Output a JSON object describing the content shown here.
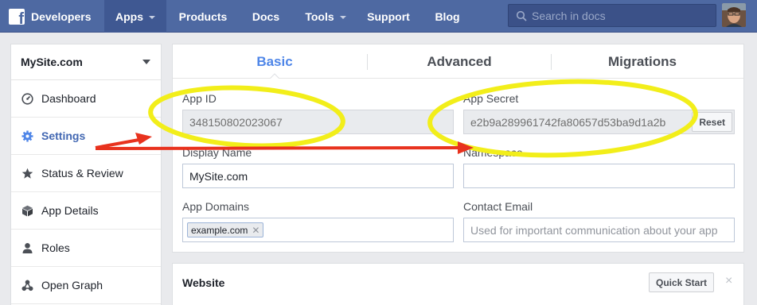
{
  "topbar": {
    "brand": "Developers",
    "nav": [
      {
        "label": "Apps",
        "active": true,
        "dropdown": true
      },
      {
        "label": "Products",
        "active": false,
        "dropdown": false
      },
      {
        "label": "Docs",
        "active": false,
        "dropdown": false
      },
      {
        "label": "Tools",
        "active": false,
        "dropdown": true
      },
      {
        "label": "Support",
        "active": false,
        "dropdown": false
      },
      {
        "label": "Blog",
        "active": false,
        "dropdown": false
      }
    ],
    "search_placeholder": "Search in docs"
  },
  "sidebar": {
    "site": "MySite.com",
    "items": [
      {
        "label": "Dashboard",
        "icon": "dashboard-icon",
        "active": false
      },
      {
        "label": "Settings",
        "icon": "gear-icon",
        "active": true
      },
      {
        "label": "Status & Review",
        "icon": "star-icon",
        "active": false
      },
      {
        "label": "App Details",
        "icon": "box-icon",
        "active": false
      },
      {
        "label": "Roles",
        "icon": "person-icon",
        "active": false
      },
      {
        "label": "Open Graph",
        "icon": "graph-icon",
        "active": false
      }
    ]
  },
  "tabs": [
    {
      "label": "Basic",
      "active": true
    },
    {
      "label": "Advanced",
      "active": false
    },
    {
      "label": "Migrations",
      "active": false
    }
  ],
  "fields": {
    "app_id": {
      "label": "App ID",
      "value": "348150802023067"
    },
    "app_secret": {
      "label": "App Secret",
      "value": "e2b9a289961742fa80657d53ba9d1a2b",
      "reset_label": "Reset"
    },
    "display_name": {
      "label": "Display Name",
      "value": "MySite.com"
    },
    "namespace": {
      "label": "Namespace",
      "value": ""
    },
    "app_domains": {
      "label": "App Domains",
      "tags": [
        "example.com"
      ]
    },
    "contact_email": {
      "label": "Contact Email",
      "placeholder": "Used for important communication about your app"
    }
  },
  "website": {
    "title": "Website",
    "quick_start_label": "Quick Start",
    "close_label": "×"
  },
  "colors": {
    "topbar": "#4e69a2",
    "accent": "#4f86e8",
    "highlight": "#f2ee1a",
    "arrow": "#e8321e"
  }
}
